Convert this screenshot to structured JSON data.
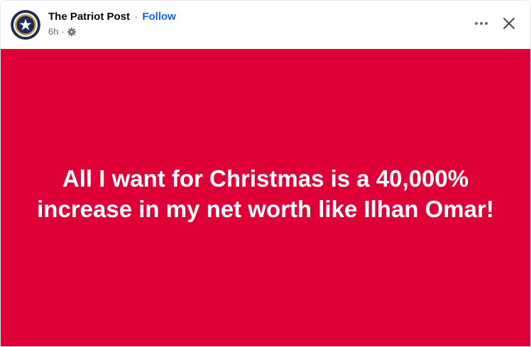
{
  "post": {
    "page_name": "The Patriot Post",
    "separator": "·",
    "follow_label": "Follow",
    "timestamp": "6h",
    "meta_separator": "·",
    "audience_icon": "gear-icon",
    "more_icon": "more-options-icon",
    "close_icon": "close-icon",
    "image": {
      "background_color": "#e00038",
      "text_color": "#ffffff",
      "lines": [
        "All I want for Christmas is a 40,000%",
        "increase in my net worth like Ilhan Omar!"
      ]
    }
  },
  "colors": {
    "link": "#0866ff",
    "secondary_text": "#65676b",
    "primary_text": "#050505",
    "avatar_ring": "#1c2e54",
    "avatar_gold": "#c9a24a"
  }
}
